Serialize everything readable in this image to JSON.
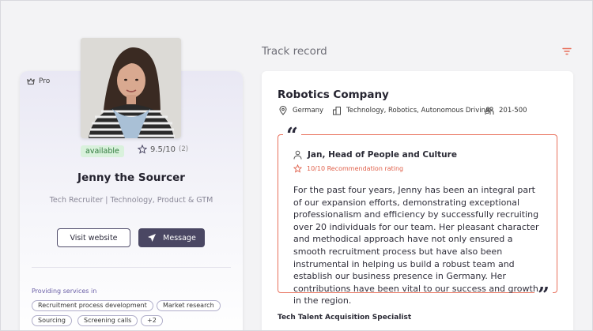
{
  "profile": {
    "badge": "Pro",
    "status": "available",
    "rating": "9.5/10",
    "rating_count": "(2)",
    "name": "Jenny the Sourcer",
    "title": "Tech Recruiter | Technology, Product & GTM",
    "visit_label": "Visit website",
    "message_label": "Message",
    "services_label": "Providing services in",
    "services": [
      "Recruitment process development",
      "Market research",
      "Sourcing",
      "Screening calls",
      "+2"
    ]
  },
  "track_record": {
    "heading": "Track record",
    "company": "Robotics Company",
    "location": "Germany",
    "industry": "Technology, Robotics, Autonomous Driving",
    "size": "201-500",
    "recommender": "Jan, Head of People and Culture",
    "recommendation_rating": "10/10 Recommendation rating",
    "quote": "For the past four years, Jenny has been an integral part of our expansion efforts, demonstrating exceptional professionalism and efficiency by successfully recruiting over 20 individuals for our team. Her pleasant character and methodical approach have not only ensured a smooth recruitment process but have also been instrumental in helping us build a robust team and establish our business presence in Germany. Her contributions have been vital to our success and growth in the region.",
    "role": "Tech Talent Acquisition Specialist"
  },
  "colors": {
    "accent": "#e8705c",
    "primary": "#4a4763",
    "available_bg": "#d9f1dc"
  },
  "icons": [
    "crown-icon",
    "star-icon",
    "send-icon",
    "filter-icon",
    "location-icon",
    "building-icon",
    "people-icon",
    "person-icon",
    "star-outline-icon"
  ]
}
